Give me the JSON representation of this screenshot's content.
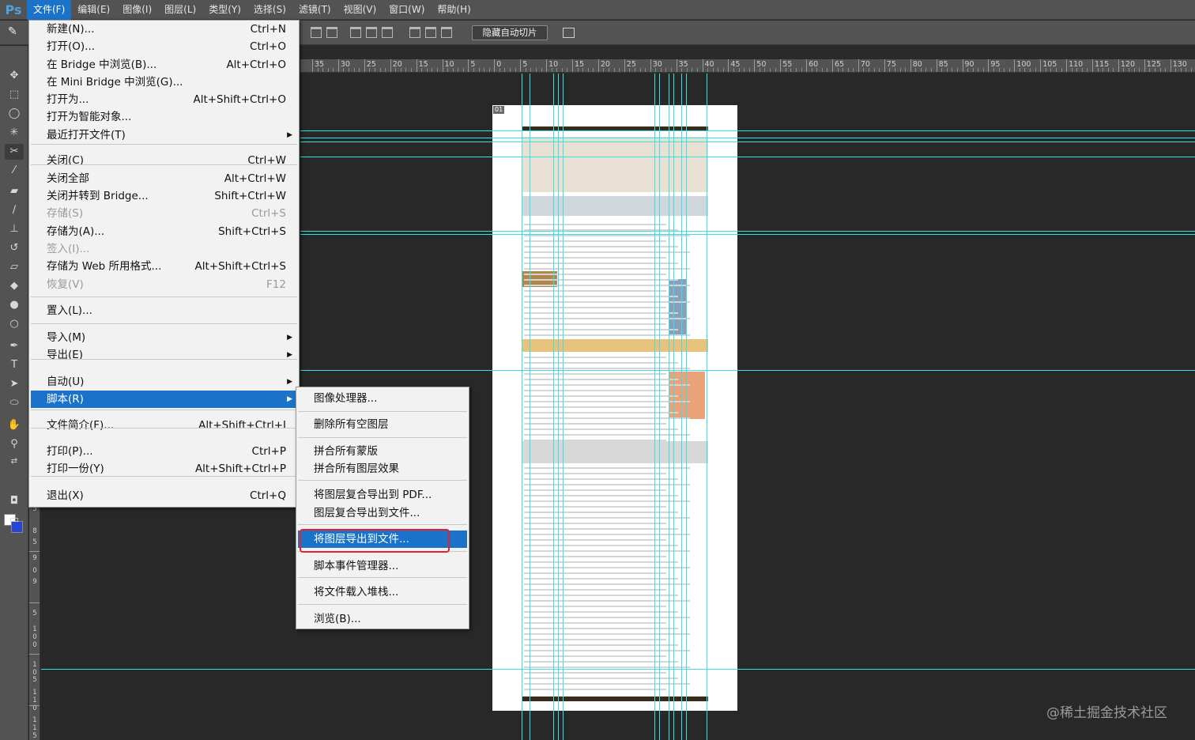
{
  "app": {
    "logo": "Ps"
  },
  "menubar": {
    "items": [
      "文件(F)",
      "编辑(E)",
      "图像(I)",
      "图层(L)",
      "类型(Y)",
      "选择(S)",
      "滤镜(T)",
      "视图(V)",
      "窗口(W)",
      "帮助(H)"
    ],
    "active_index": 0
  },
  "options_bar": {
    "hide_slices_label": "隐藏自动切片"
  },
  "ruler_top": {
    "labels": [
      "35",
      "30",
      "25",
      "20",
      "15",
      "10",
      "5",
      "0",
      "5",
      "10",
      "15",
      "20",
      "25",
      "30",
      "35",
      "40",
      "45",
      "50",
      "55",
      "60",
      "65",
      "70",
      "75",
      "80",
      "85",
      "90",
      "95",
      "100",
      "105",
      "110",
      "115",
      "120",
      "125",
      "130"
    ]
  },
  "ruler_left": {
    "labels": [
      "5",
      "8",
      "5",
      "9",
      "0",
      "9",
      "5",
      "1",
      "0",
      "0",
      "1",
      "0",
      "5",
      "1",
      "1",
      "0",
      "1",
      "1",
      "5"
    ]
  },
  "file_menu": {
    "items": [
      {
        "label": "新建(N)...",
        "shortcut": "Ctrl+N"
      },
      {
        "label": "打开(O)...",
        "shortcut": "Ctrl+O"
      },
      {
        "label": "在 Bridge 中浏览(B)...",
        "shortcut": "Alt+Ctrl+O"
      },
      {
        "label": "在 Mini Bridge 中浏览(G)...",
        "shortcut": ""
      },
      {
        "label": "打开为...",
        "shortcut": "Alt+Shift+Ctrl+O"
      },
      {
        "label": "打开为智能对象...",
        "shortcut": ""
      },
      {
        "label": "最近打开文件(T)",
        "shortcut": "",
        "submenu": true
      },
      {
        "label": "关闭(C)",
        "shortcut": "Ctrl+W"
      },
      {
        "label": "关闭全部",
        "shortcut": "Alt+Ctrl+W"
      },
      {
        "label": "关闭并转到 Bridge...",
        "shortcut": "Shift+Ctrl+W"
      },
      {
        "label": "存储(S)",
        "shortcut": "Ctrl+S",
        "disabled": true
      },
      {
        "label": "存储为(A)...",
        "shortcut": "Shift+Ctrl+S"
      },
      {
        "label": "签入(I)...",
        "shortcut": "",
        "disabled": true
      },
      {
        "label": "存储为 Web 所用格式...",
        "shortcut": "Alt+Shift+Ctrl+S"
      },
      {
        "label": "恢复(V)",
        "shortcut": "F12",
        "disabled": true
      },
      {
        "label": "置入(L)...",
        "shortcut": ""
      },
      {
        "label": "导入(M)",
        "shortcut": "",
        "submenu": true
      },
      {
        "label": "导出(E)",
        "shortcut": "",
        "submenu": true
      },
      {
        "label": "自动(U)",
        "shortcut": "",
        "submenu": true
      },
      {
        "label": "脚本(R)",
        "shortcut": "",
        "submenu": true,
        "highlighted": true
      },
      {
        "label": "文件简介(F)...",
        "shortcut": "Alt+Shift+Ctrl+I"
      },
      {
        "label": "打印(P)...",
        "shortcut": "Ctrl+P"
      },
      {
        "label": "打印一份(Y)",
        "shortcut": "Alt+Shift+Ctrl+P"
      },
      {
        "label": "退出(X)",
        "shortcut": "Ctrl+Q"
      }
    ]
  },
  "scripts_submenu": {
    "items": [
      {
        "label": "图像处理器..."
      },
      {
        "label": "删除所有空图层"
      },
      {
        "label": "拼合所有蒙版"
      },
      {
        "label": "拼合所有图层效果"
      },
      {
        "label": "将图层复合导出到 PDF..."
      },
      {
        "label": "图层复合导出到文件..."
      },
      {
        "label": "将图层导出到文件...",
        "highlighted": true
      },
      {
        "label": "脚本事件管理器..."
      },
      {
        "label": "将文件载入堆栈..."
      },
      {
        "label": "浏览(B)..."
      }
    ]
  },
  "document": {
    "slice_tag": "01"
  },
  "watermark": "@稀土掘金技术社区",
  "colors": {
    "accent": "#1b73c9",
    "guide": "#39e0e6",
    "highlight_box": "#e8222b",
    "bg_swatch": "#2844d6"
  },
  "tools": [
    "move-icon",
    "marquee-icon",
    "lasso-icon",
    "magic-wand-icon",
    "slice-icon",
    "eyedropper-icon",
    "healing-brush-icon",
    "brush-icon",
    "clone-stamp-icon",
    "history-brush-icon",
    "eraser-icon",
    "paint-bucket-icon",
    "blur-icon",
    "dodge-icon",
    "pen-icon",
    "type-icon",
    "path-select-icon",
    "shape-icon",
    "hand-icon",
    "zoom-icon"
  ]
}
